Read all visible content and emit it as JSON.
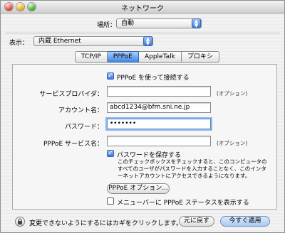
{
  "window": {
    "title": "ネットワーク"
  },
  "location": {
    "label": "場所：",
    "value": "自動"
  },
  "show": {
    "label": "表示：",
    "value": "内蔵 Ethernet"
  },
  "tabs": [
    {
      "label": "TCP/IP",
      "active": false
    },
    {
      "label": "PPPoE",
      "active": true
    },
    {
      "label": "AppleTalk",
      "active": false
    },
    {
      "label": "プロキシ",
      "active": false
    }
  ],
  "pppoe": {
    "connect_checkbox": "PPPoE を使って接続する",
    "provider_label": "サービスプロバイダ：",
    "provider_value": "",
    "optional_1": "(オプション)",
    "account_label": "アカウント名：",
    "account_value": "abcd1234@bfm.sni.ne.jp",
    "password_label": "パスワード：",
    "password_value": "•••••••",
    "service_label": "PPPoE サービス名：",
    "service_value": "",
    "optional_2": "(オプション)",
    "save_password_checkbox": "パスワードを保存する",
    "save_password_desc_1": "このチェックボックスをチェックすると、このコンピュータの",
    "save_password_desc_2": "すべてのユーザがパスワードを入力することなく、このインタ",
    "save_password_desc_3": "ーネットアカウントにアクセスできるようになります。",
    "options_button": "PPPoE オプション...",
    "menubar_checkbox": "メニューバーに PPPoE ステータスを表示する"
  },
  "footer": {
    "lock_text": "変更できないようにするにはカギをクリックします。",
    "revert_button": "元に戻す",
    "apply_button": "今すぐ適用"
  }
}
